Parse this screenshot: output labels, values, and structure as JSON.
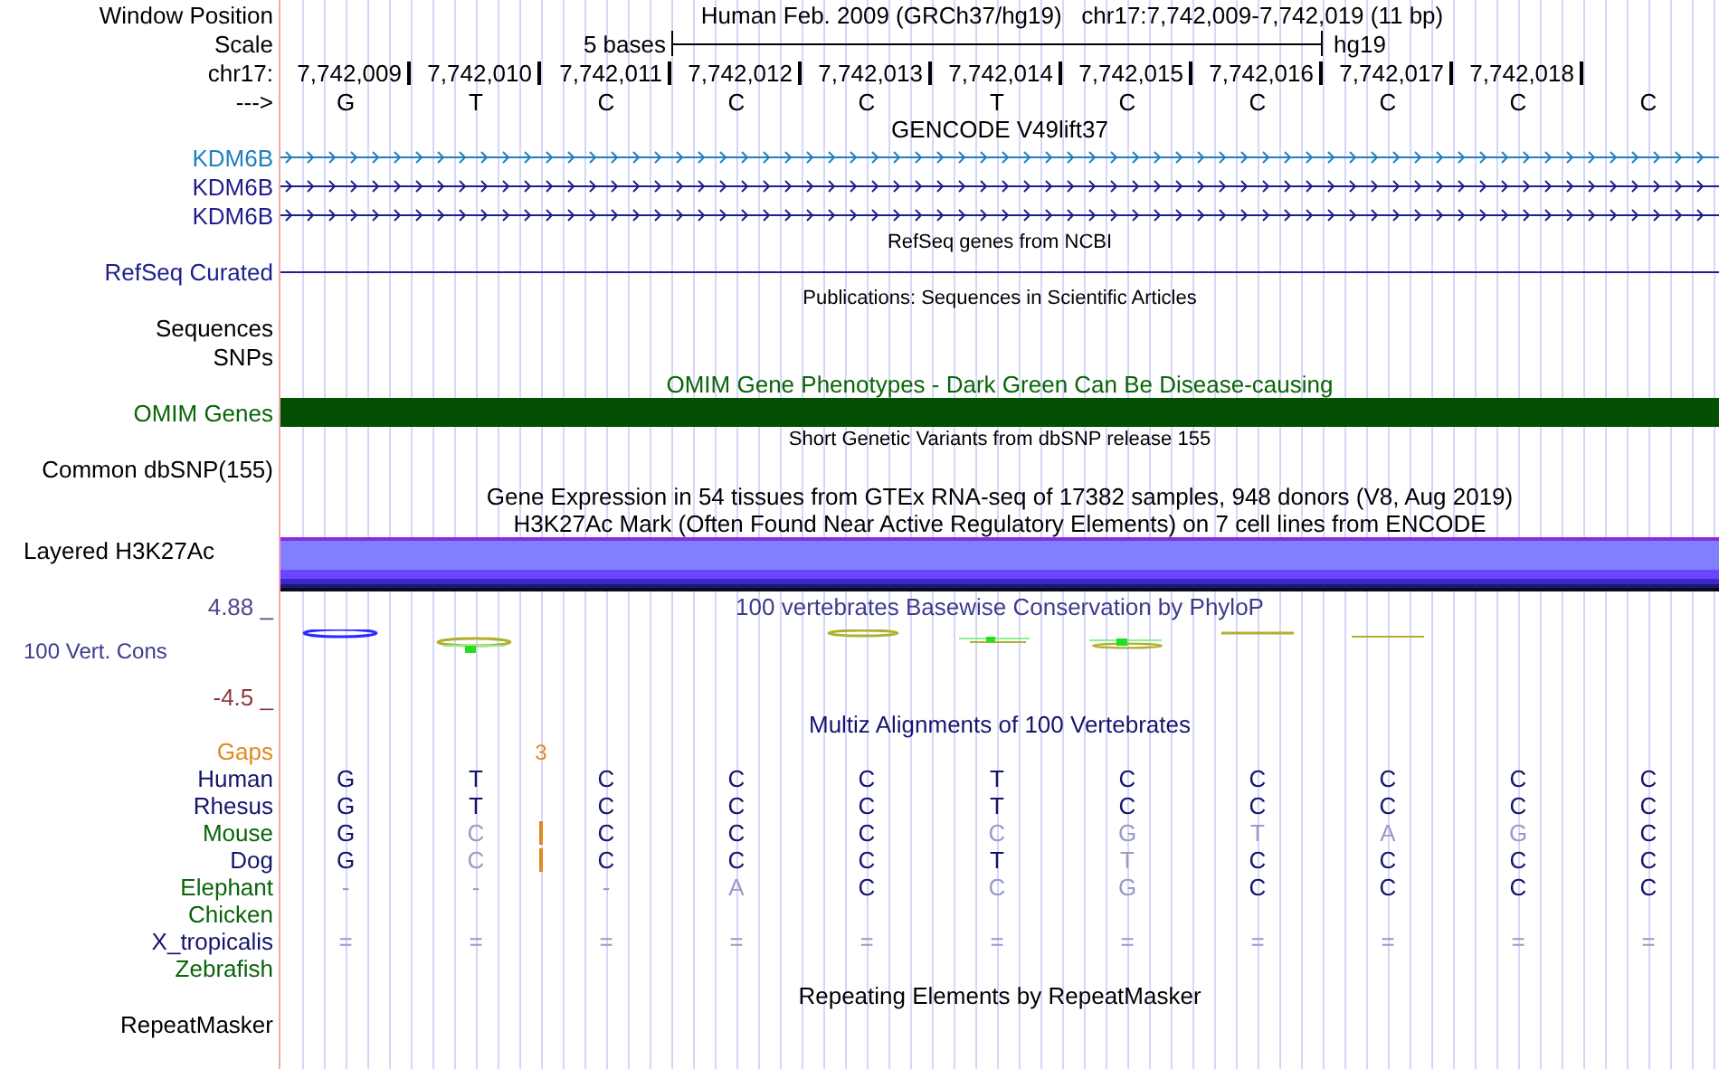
{
  "header": {
    "window_label": "Window Position",
    "title": "Human Feb. 2009 (GRCh37/hg19)   chr17:7,742,009-7,742,019 (11 bp)",
    "scale_label": "Scale",
    "scale_text": "5 bases",
    "assembly": "hg19",
    "chrom_label": "chr17:",
    "strand_label": "--->",
    "positions": [
      "7,742,009",
      "7,742,010",
      "7,742,011",
      "7,742,012",
      "7,742,013",
      "7,742,014",
      "7,742,015",
      "7,742,016",
      "7,742,017",
      "7,742,018"
    ],
    "bases": [
      "G",
      "T",
      "C",
      "C",
      "C",
      "T",
      "C",
      "C",
      "C",
      "C",
      "C"
    ]
  },
  "tracks": [
    {
      "kind": "title",
      "text": "GENCODE V49lift37",
      "color": "#000000"
    },
    {
      "kind": "gene",
      "label": "KDM6B",
      "color": "#1f7fbf"
    },
    {
      "kind": "gene",
      "label": "KDM6B",
      "color": "#1e1e8c"
    },
    {
      "kind": "gene",
      "label": "KDM6B",
      "color": "#1e1e8c"
    },
    {
      "kind": "note",
      "text": "RefSeq genes from NCBI"
    },
    {
      "kind": "line",
      "label": "RefSeq Curated",
      "color": "#1e1e8c"
    },
    {
      "kind": "note",
      "text": "Publications: Sequences in Scientific Articles"
    },
    {
      "kind": "label",
      "label": "Sequences",
      "color": "#000000"
    },
    {
      "kind": "label",
      "label": "SNPs",
      "color": "#000000"
    },
    {
      "kind": "title",
      "text": "OMIM Gene Phenotypes - Dark Green Can Be Disease-causing",
      "color": "#0a640a"
    },
    {
      "kind": "bar",
      "label": "OMIM Genes",
      "color": "#0a640a"
    },
    {
      "kind": "note",
      "text": "Short Genetic Variants from dbSNP release 155"
    },
    {
      "kind": "label",
      "label": "Common dbSNP(155)",
      "color": "#000000"
    },
    {
      "kind": "title",
      "text": "Gene Expression in 54 tissues from GTEx RNA-seq of 17382 samples, 948 donors (V8, Aug 2019)",
      "color": "#000000"
    },
    {
      "kind": "title",
      "text": "H3K27Ac Mark (Often Found Near Active Regulatory Elements) on 7 cell lines from ENCODE",
      "color": "#000000"
    },
    {
      "kind": "layered",
      "label": "Layered H3K27Ac",
      "color": "#000000"
    },
    {
      "kind": "wiggle",
      "label": "100 Vert. Cons",
      "top": "4.88 _",
      "bottom": "-4.5 _",
      "title": "100 vertebrates Basewise Conservation by PhyloP",
      "color": "#3c3c8c"
    },
    {
      "kind": "title",
      "text": "Multiz Alignments of 100 Vertebrates",
      "color": "#14146e"
    },
    {
      "kind": "gaps",
      "label": "Gaps",
      "count": "3",
      "color": "#e08a1e"
    },
    {
      "kind": "species",
      "label": "Human",
      "color": "#14146e",
      "insertion": false,
      "bases": [
        {
          "base": "G",
          "differs": false
        },
        {
          "base": "T",
          "differs": false
        },
        {
          "base": "C",
          "differs": false
        },
        {
          "base": "C",
          "differs": false
        },
        {
          "base": "C",
          "differs": false
        },
        {
          "base": "T",
          "differs": false
        },
        {
          "base": "C",
          "differs": false
        },
        {
          "base": "C",
          "differs": false
        },
        {
          "base": "C",
          "differs": false
        },
        {
          "base": "C",
          "differs": false
        },
        {
          "base": "C",
          "differs": false
        }
      ]
    },
    {
      "kind": "species",
      "label": "Rhesus",
      "color": "#14146e",
      "insertion": false,
      "bases": [
        {
          "base": "G",
          "differs": false
        },
        {
          "base": "T",
          "differs": false
        },
        {
          "base": "C",
          "differs": false
        },
        {
          "base": "C",
          "differs": false
        },
        {
          "base": "C",
          "differs": false
        },
        {
          "base": "T",
          "differs": false
        },
        {
          "base": "C",
          "differs": false
        },
        {
          "base": "C",
          "differs": false
        },
        {
          "base": "C",
          "differs": false
        },
        {
          "base": "C",
          "differs": false
        },
        {
          "base": "C",
          "differs": false
        }
      ]
    },
    {
      "kind": "species",
      "label": "Mouse",
      "color": "#0a640a",
      "insertion": true,
      "bases": [
        {
          "base": "G",
          "differs": false
        },
        {
          "base": "C",
          "differs": true
        },
        {
          "base": "C",
          "differs": false
        },
        {
          "base": "C",
          "differs": false
        },
        {
          "base": "C",
          "differs": false
        },
        {
          "base": "C",
          "differs": true
        },
        {
          "base": "G",
          "differs": true
        },
        {
          "base": "T",
          "differs": true
        },
        {
          "base": "A",
          "differs": true
        },
        {
          "base": "G",
          "differs": true
        },
        {
          "base": "C",
          "differs": false
        }
      ]
    },
    {
      "kind": "species",
      "label": "Dog",
      "color": "#14146e",
      "insertion": true,
      "bases": [
        {
          "base": "G",
          "differs": false
        },
        {
          "base": "C",
          "differs": true
        },
        {
          "base": "C",
          "differs": false
        },
        {
          "base": "C",
          "differs": false
        },
        {
          "base": "C",
          "differs": false
        },
        {
          "base": "T",
          "differs": false
        },
        {
          "base": "T",
          "differs": true
        },
        {
          "base": "C",
          "differs": false
        },
        {
          "base": "C",
          "differs": false
        },
        {
          "base": "C",
          "differs": false
        },
        {
          "base": "C",
          "differs": false
        }
      ]
    },
    {
      "kind": "species",
      "label": "Elephant",
      "color": "#0a640a",
      "insertion": false,
      "bases": [
        {
          "base": "-",
          "differs": true
        },
        {
          "base": "-",
          "differs": true
        },
        {
          "base": "-",
          "differs": true
        },
        {
          "base": "A",
          "differs": true
        },
        {
          "base": "C",
          "differs": false
        },
        {
          "base": "C",
          "differs": true
        },
        {
          "base": "G",
          "differs": true
        },
        {
          "base": "C",
          "differs": false
        },
        {
          "base": "C",
          "differs": false
        },
        {
          "base": "C",
          "differs": false
        },
        {
          "base": "C",
          "differs": false
        }
      ]
    },
    {
      "kind": "species",
      "label": "Chicken",
      "color": "#0a640a",
      "insertion": false
    },
    {
      "kind": "species",
      "label": "X_tropicalis",
      "color": "#14146e",
      "insertion": false,
      "bases": [
        {
          "base": "=",
          "differs": true
        },
        {
          "base": "=",
          "differs": true
        },
        {
          "base": "=",
          "differs": true
        },
        {
          "base": "=",
          "differs": true
        },
        {
          "base": "=",
          "differs": true
        },
        {
          "base": "=",
          "differs": true
        },
        {
          "base": "=",
          "differs": true
        },
        {
          "base": "=",
          "differs": true
        },
        {
          "base": "=",
          "differs": true
        },
        {
          "base": "=",
          "differs": true
        },
        {
          "base": "=",
          "differs": true
        }
      ]
    },
    {
      "kind": "species",
      "label": "Zebrafish",
      "color": "#0a640a",
      "insertion": false
    },
    {
      "kind": "title",
      "text": "Repeating Elements by RepeatMasker",
      "color": "#000000"
    },
    {
      "kind": "label",
      "label": "RepeatMasker",
      "color": "#000000"
    }
  ]
}
